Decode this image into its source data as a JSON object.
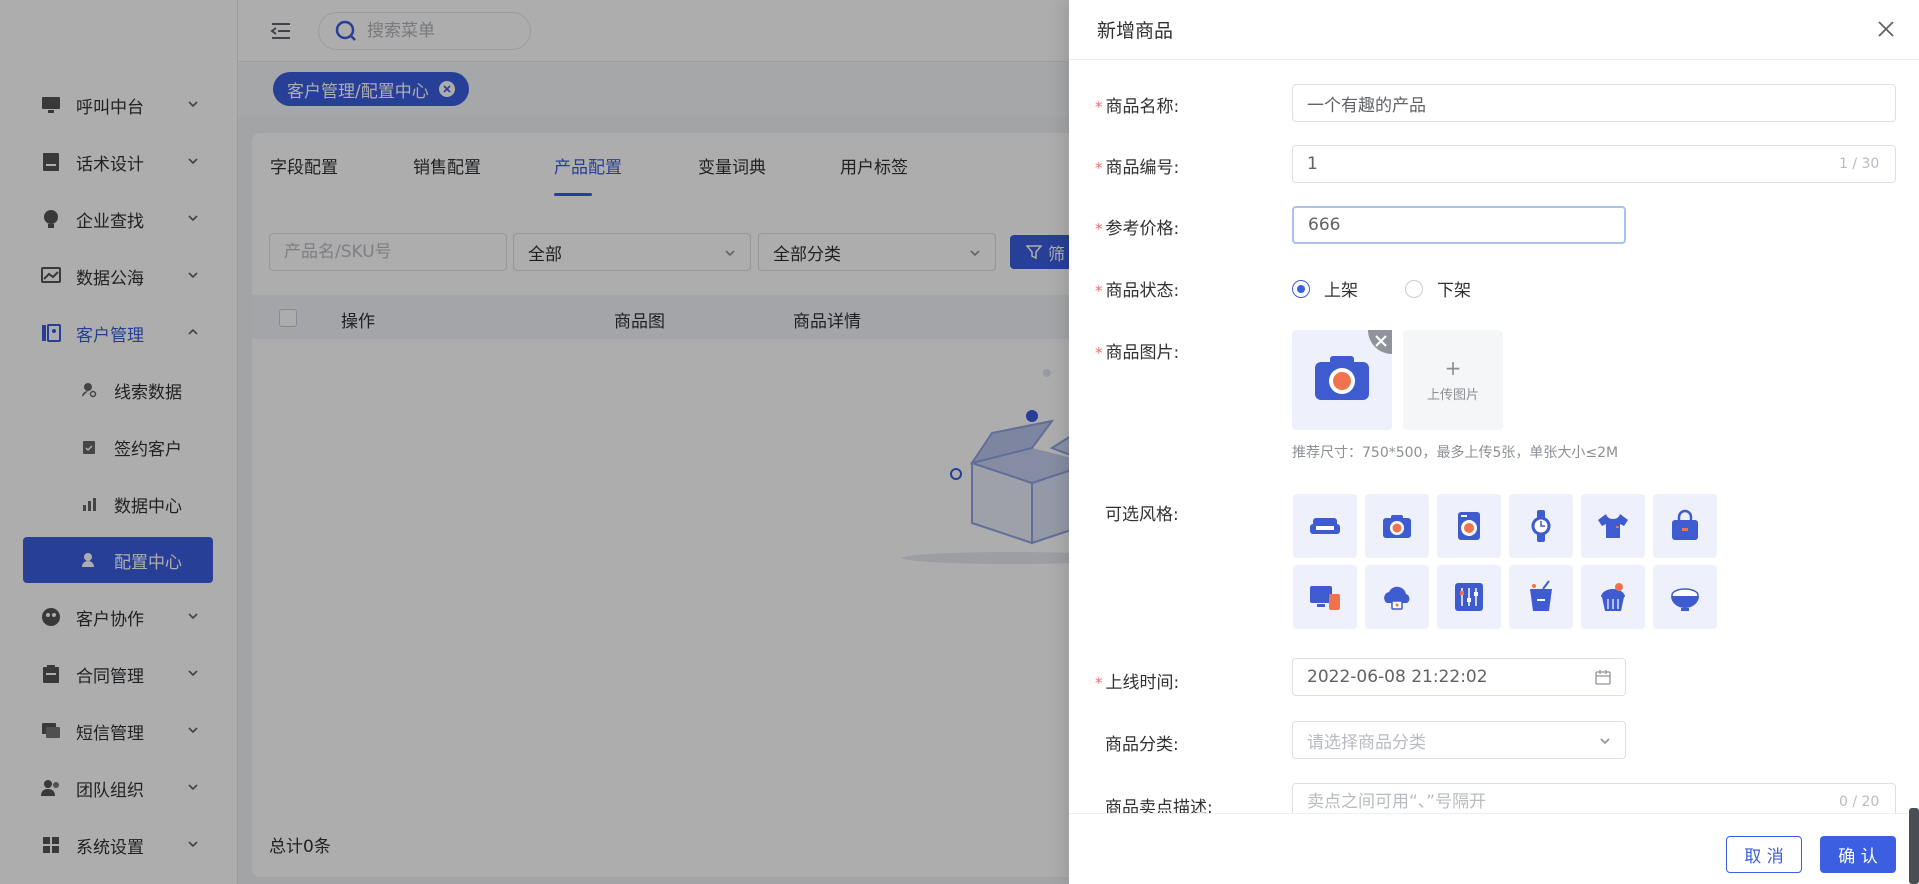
{
  "sidebar": {
    "items": [
      {
        "label": "呼叫中台",
        "icon": "monitor-icon"
      },
      {
        "label": "话术设计",
        "icon": "script-icon"
      },
      {
        "label": "企业查找",
        "icon": "bulb-icon"
      },
      {
        "label": "数据公海",
        "icon": "chart-icon"
      },
      {
        "label": "客户管理",
        "icon": "contact-card-icon"
      },
      {
        "label": "客户协作",
        "icon": "collaboration-icon"
      },
      {
        "label": "合同管理",
        "icon": "clipboard-icon"
      },
      {
        "label": "短信管理",
        "icon": "message-icon"
      },
      {
        "label": "团队组织",
        "icon": "team-icon"
      },
      {
        "label": "系统设置",
        "icon": "dashboard-icon"
      }
    ],
    "sub_items": [
      {
        "label": "线索数据",
        "icon": "user-search-icon"
      },
      {
        "label": "签约客户",
        "icon": "contract-icon"
      },
      {
        "label": "数据中心",
        "icon": "bar-chart-icon"
      },
      {
        "label": "配置中心",
        "icon": "user-gear-icon"
      }
    ]
  },
  "topbar": {
    "search_placeholder": "搜索菜单",
    "page_tag": "客户管理/配置中心"
  },
  "main": {
    "tabs": [
      "字段配置",
      "销售配置",
      "产品配置",
      "变量词典",
      "用户标签"
    ],
    "active_tab": "产品配置",
    "filters": {
      "search_placeholder": "产品名/SKU号",
      "status_value": "全部",
      "category_value": "全部分类",
      "filter_button": "筛"
    },
    "table_headers": [
      "操作",
      "商品图",
      "商品详情"
    ],
    "total": "总计0条"
  },
  "drawer": {
    "title": "新增商品",
    "fields": {
      "name_label": "商品名称:",
      "name_value": "一个有趣的产品",
      "code_label": "商品编号:",
      "code_value": "1",
      "code_counter": "1 / 30",
      "price_label": "参考价格:",
      "price_value": "666",
      "status_label": "商品状态:",
      "status_on": "上架",
      "status_off": "下架",
      "image_label": "商品图片:",
      "upload_label": "上传图片",
      "image_hint": "推荐尺寸：750*500，最多上传5张，单张大小≤2M",
      "style_label": "可选风格:",
      "online_label": "上线时间:",
      "online_value": "2022-06-08 21:22:02",
      "category_label": "商品分类:",
      "category_placeholder": "请选择商品分类",
      "selling_label": "商品卖点描述:",
      "selling_placeholder": "卖点之间可用“、”号隔开",
      "selling_counter": "0 / 20"
    },
    "styles": [
      "sofa-icon",
      "camera-icon",
      "washing-machine-icon",
      "watch-icon",
      "tshirt-icon",
      "bag-icon",
      "devices-icon",
      "cloud-icon",
      "mixer-icon",
      "drink-icon",
      "cupcake-icon",
      "rice-bowl-icon"
    ],
    "cancel": "取 消",
    "confirm": "确 认"
  },
  "colors": {
    "primary": "#3c5ee0",
    "accent_orange": "#f0734e",
    "required": "#f56c6c"
  }
}
